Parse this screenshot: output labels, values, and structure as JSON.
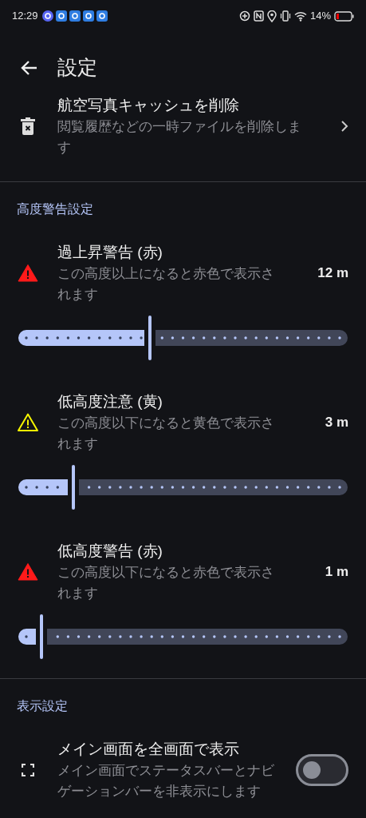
{
  "status_bar": {
    "time": "12:29",
    "battery": "14%"
  },
  "app_bar": {
    "title": "設定"
  },
  "sections": [
    {
      "items": [
        {
          "kind": "nav",
          "title": "航空写真キャッシュを削除",
          "subtitle": "閲覧履歴などの一時ファイルを削除します"
        }
      ]
    },
    {
      "header": "高度警告設定",
      "items": [
        {
          "kind": "slider",
          "title": "過上昇警告 (赤)",
          "subtitle": "この高度以上になると赤色で表示されます",
          "value": "12 m",
          "level": 0.4,
          "color": "#ff1a1a",
          "outlined": false
        },
        {
          "kind": "slider",
          "title": "低高度注意 (黄)",
          "subtitle": "この高度以下になると黄色で表示されます",
          "value": "3 m",
          "level": 0.167,
          "color": "#f5f500",
          "outlined": true
        },
        {
          "kind": "slider",
          "title": "低高度警告 (赤)",
          "subtitle": "この高度以下になると赤色で表示されます",
          "value": "1 m",
          "level": 0.07,
          "color": "#ff1a1a",
          "outlined": false
        }
      ]
    },
    {
      "header": "表示設定",
      "items": [
        {
          "kind": "toggle",
          "title": "メイン画面を全画面で表示",
          "subtitle": "メイン画面でステータスバーとナビゲーションバーを非表示にします",
          "on": false
        }
      ]
    }
  ]
}
